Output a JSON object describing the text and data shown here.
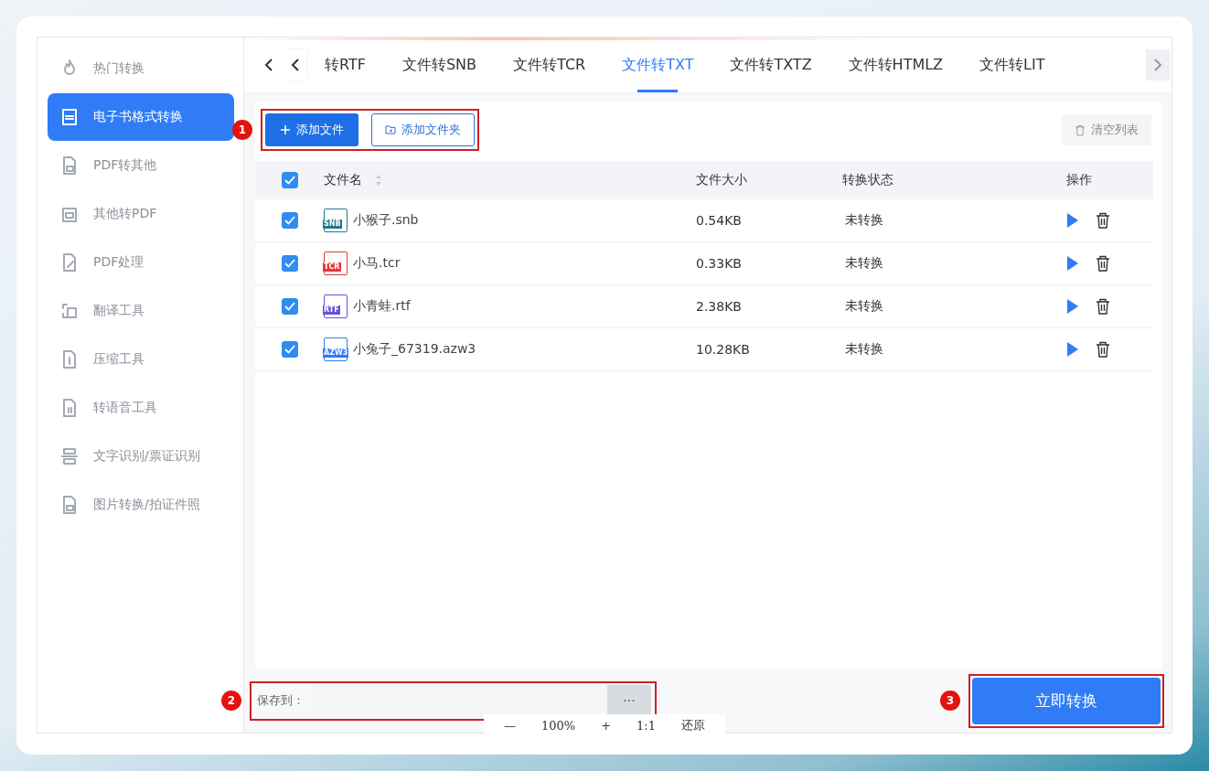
{
  "sidebar": {
    "items": [
      {
        "label": "热门转换",
        "selected": false
      },
      {
        "label": "电子书格式转换",
        "selected": true
      },
      {
        "label": "PDF转其他",
        "selected": false
      },
      {
        "label": "其他转PDF",
        "selected": false
      },
      {
        "label": "PDF处理",
        "selected": false
      },
      {
        "label": "翻译工具",
        "selected": false
      },
      {
        "label": "压缩工具",
        "selected": false
      },
      {
        "label": "转语音工具",
        "selected": false
      },
      {
        "label": "文字识别/票证识别",
        "selected": false
      },
      {
        "label": "图片转换/拍证件照",
        "selected": false
      }
    ]
  },
  "tabs": [
    {
      "label": "转RTF",
      "selected": false
    },
    {
      "label": "文件转SNB",
      "selected": false
    },
    {
      "label": "文件转TCR",
      "selected": false
    },
    {
      "label": "文件转TXT",
      "selected": true
    },
    {
      "label": "文件转TXTZ",
      "selected": false
    },
    {
      "label": "文件转HTMLZ",
      "selected": false
    },
    {
      "label": "文件转LIT",
      "selected": false
    }
  ],
  "toolbar": {
    "add_file": "添加文件",
    "add_folder": "添加文件夹",
    "clear_list": "清空列表"
  },
  "table": {
    "all_checked": true,
    "columns": [
      "文件名",
      "文件大小",
      "转换状态",
      "操作"
    ],
    "rows": [
      {
        "checked": true,
        "name": "小猴子.snb",
        "icon_label": "SNB",
        "color": "#1f7a8c",
        "size": "0.54KB",
        "status": "未转换"
      },
      {
        "checked": true,
        "name": "小马.tcr",
        "icon_label": "TCR",
        "color": "#e5393a",
        "size": "0.33KB",
        "status": "未转换"
      },
      {
        "checked": true,
        "name": "小青蛙.rtf",
        "icon_label": "RTF",
        "color": "#6b4fd8",
        "size": "2.38KB",
        "status": "未转换"
      },
      {
        "checked": true,
        "name": "小兔子_67319.azw3",
        "icon_label": "AZW3",
        "color": "#2f7cf6",
        "size": "10.28KB",
        "status": "未转换"
      }
    ]
  },
  "save": {
    "label": "保存到：",
    "browse": "···"
  },
  "convert_button": "立即转换",
  "annotations": [
    "1",
    "2",
    "3"
  ],
  "viewer_toolbar": [
    "—",
    "100%",
    "+",
    "1:1",
    "还原"
  ]
}
